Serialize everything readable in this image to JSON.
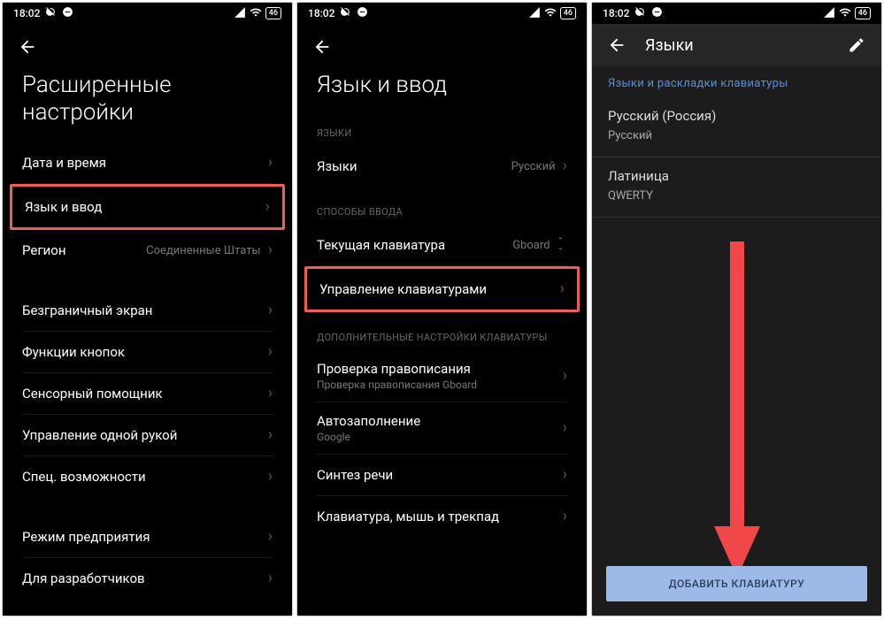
{
  "status": {
    "time": "18:02",
    "battery": "46"
  },
  "screen1": {
    "title": "Расширенные настройки",
    "rows": {
      "datetime": "Дата и время",
      "langinput": "Язык и ввод",
      "region": "Регион",
      "region_value": "Соединенные Штаты",
      "edgeless": "Безграничный экран",
      "buttons": "Функции кнопок",
      "sensor": "Сенсорный помощник",
      "onehand": "Управление одной рукой",
      "accessibility": "Спец. возможности",
      "enterprise": "Режим предприятия",
      "developer": "Для разработчиков"
    }
  },
  "screen2": {
    "title": "Язык и ввод",
    "sections": {
      "languages": "ЯЗЫКИ",
      "input_methods": "СПОСОБЫ ВВОДА",
      "extra": "ДОПОЛНИТЕЛЬНЫЕ НАСТРОЙКИ КЛАВИАТУРЫ"
    },
    "rows": {
      "languages": "Языки",
      "languages_value": "Русский",
      "current_kb": "Текущая клавиатура",
      "current_kb_value": "Gboard",
      "manage_kb": "Управление клавиатурами",
      "spellcheck": "Проверка правописания",
      "spellcheck_sub": "Проверка правописания Gboard",
      "autofill": "Автозаполнение",
      "autofill_sub": "Google",
      "tts": "Синтез речи",
      "kmt": "Клавиатура, мышь и трекпад"
    }
  },
  "screen3": {
    "title": "Языки",
    "section": "Языки и раскладки клавиатуры",
    "block1": {
      "l1": "Русский (Россия)",
      "l2": "Русский"
    },
    "block2": {
      "l1": "Латиница",
      "l2": "QWERTY"
    },
    "add_button": "ДОБАВИТЬ КЛАВИАТУРУ"
  }
}
